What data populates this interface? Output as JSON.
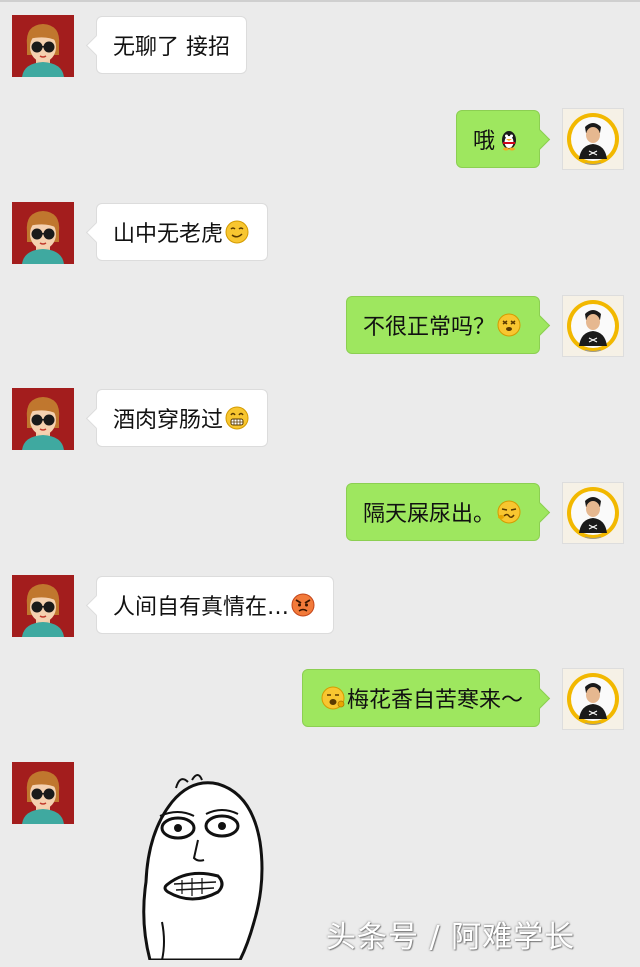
{
  "chat": {
    "messages": [
      {
        "side": "left",
        "text": "无聊了 接招",
        "emoji": ""
      },
      {
        "side": "right",
        "text": "哦",
        "emoji": "qq-penguin-icon"
      },
      {
        "side": "left",
        "text": "山中无老虎",
        "emoji": "smug-face-icon"
      },
      {
        "side": "right",
        "text": "不很正常吗？",
        "emoji": "dizzy-face-icon"
      },
      {
        "side": "left",
        "text": "酒肉穿肠过",
        "emoji": "grin-face-icon"
      },
      {
        "side": "right",
        "text": "隔天屎尿出。",
        "emoji": "grimace-face-icon"
      },
      {
        "side": "left",
        "text": "人间自有真情在…",
        "emoji": "angry-face-icon"
      },
      {
        "side": "right",
        "text": "梅花香自苦寒来～",
        "emoji": "yawn-face-icon"
      }
    ],
    "last_message": {
      "side": "left",
      "type": "sticker",
      "sticker": "rage-face-meme"
    }
  },
  "watermark": "头条号 / 阿难学长",
  "colors": {
    "background": "#ebebeb",
    "sent_bubble": "#9ee75f",
    "received_bubble": "#ffffff",
    "left_avatar_bg": "#a31d1d",
    "right_avatar_ring": "#f2b800"
  }
}
